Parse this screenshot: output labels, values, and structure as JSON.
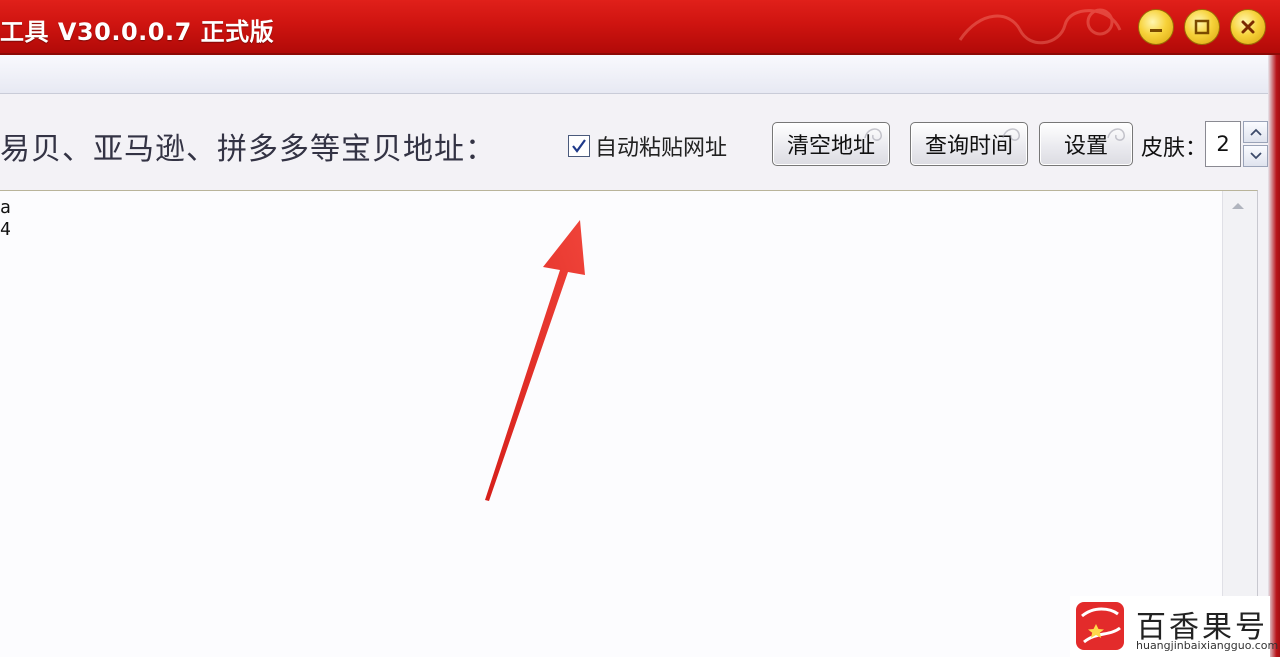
{
  "window": {
    "title": "工具 V30.0.0.7 正式版",
    "accent_color": "#cc1410",
    "controls": {
      "minimize_icon": "minimize-icon",
      "maximize_icon": "maximize-icon",
      "close_icon": "close-icon"
    }
  },
  "toolbar": {
    "prompt_label": "易贝、亚马逊、拼多多等宝贝地址：",
    "auto_paste": {
      "label": "自动粘贴网址",
      "checked": true
    },
    "clear_button": "清空地址",
    "query_button": "查询时间",
    "settings_button": "设置",
    "skin": {
      "label": "皮肤：",
      "value": "2"
    }
  },
  "editor": {
    "lines": [
      "a",
      "4"
    ]
  },
  "annotation": {
    "type": "red-arrow",
    "color": "#e8302a"
  },
  "watermark": {
    "name": "百香果号",
    "url": "huangjinbaixiangguo.com",
    "logo_color": "#e32b2b"
  }
}
